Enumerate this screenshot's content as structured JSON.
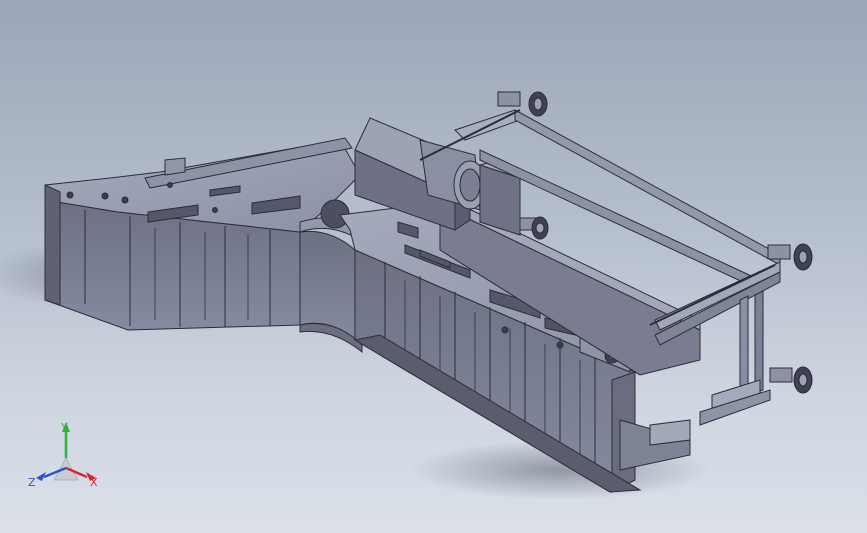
{
  "viewport": {
    "background_top": "#9ca6b8",
    "background_bottom": "#dbe0e8"
  },
  "model": {
    "part_color": "#7f8296",
    "edge_color": "#2b2d36",
    "highlight_color": "#a9aec0",
    "shadow_color": "#4d5060"
  },
  "triad": {
    "x_label": "X",
    "y_label": "Y",
    "z_label": "Z",
    "x_color": "#d9262b",
    "y_color": "#2fb33a",
    "z_color": "#2b57c9"
  }
}
